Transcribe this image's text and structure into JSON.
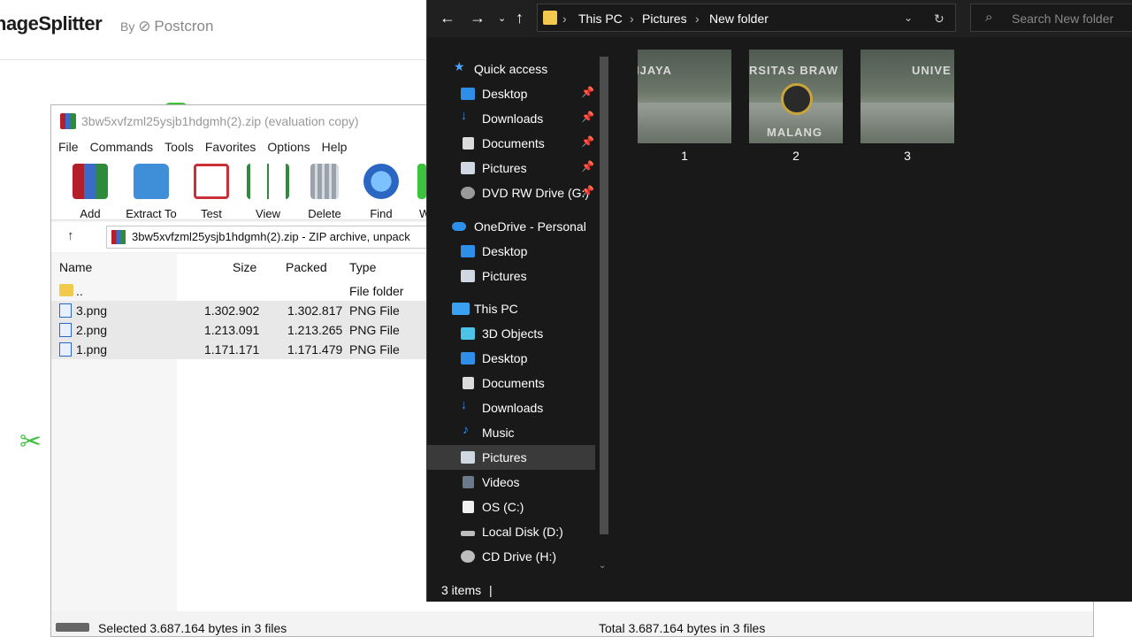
{
  "web": {
    "logo": "nageSplitter",
    "by": "By",
    "brand": "Postcron"
  },
  "rar": {
    "title": "3bw5xvfzml25ysjb1hdgmh(2).zip (evaluation copy)",
    "menu": [
      "File",
      "Commands",
      "Tools",
      "Favorites",
      "Options",
      "Help"
    ],
    "toolbar": [
      "Add",
      "Extract To",
      "Test",
      "View",
      "Delete",
      "Find",
      "W"
    ],
    "address": "3bw5xvfzml25ysjb1hdgmh(2).zip - ZIP archive, unpack",
    "columns": {
      "name": "Name",
      "size": "Size",
      "packed": "Packed",
      "type": "Type"
    },
    "rows": [
      {
        "name": "..",
        "size": "",
        "packed": "",
        "type": "File folder"
      },
      {
        "name": "3.png",
        "size": "1.302.902",
        "packed": "1.302.817",
        "type": "PNG File"
      },
      {
        "name": "2.png",
        "size": "1.213.091",
        "packed": "1.213.265",
        "type": "PNG File"
      },
      {
        "name": "1.png",
        "size": "1.171.171",
        "packed": "1.171.479",
        "type": "PNG File"
      }
    ],
    "status_left": "Selected 3.687.164 bytes in 3 files",
    "status_right": "Total 3.687.164 bytes in 3 files"
  },
  "explorer": {
    "path": [
      "This PC",
      "Pictures",
      "New folder"
    ],
    "search_placeholder": "Search New folder",
    "nav": [
      {
        "label": "Quick access",
        "icon": "star-icon",
        "pinned": false
      },
      {
        "label": "Desktop",
        "icon": "desktop-icon",
        "pinned": true
      },
      {
        "label": "Downloads",
        "icon": "download-icon",
        "pinned": true
      },
      {
        "label": "Documents",
        "icon": "document-icon",
        "pinned": true
      },
      {
        "label": "Pictures",
        "icon": "pictures-icon",
        "pinned": true
      },
      {
        "label": "DVD RW Drive (G:)",
        "icon": "dvd-icon",
        "pinned": true
      },
      {
        "label": "OneDrive - Personal",
        "icon": "cloud-icon",
        "pinned": false
      },
      {
        "label": "Desktop",
        "icon": "desktop-icon",
        "pinned": false
      },
      {
        "label": "Pictures",
        "icon": "pictures-icon",
        "pinned": false
      },
      {
        "label": "This PC",
        "icon": "pc-icon",
        "pinned": false
      },
      {
        "label": "3D Objects",
        "icon": "cube-icon",
        "pinned": false
      },
      {
        "label": "Desktop",
        "icon": "desktop-icon",
        "pinned": false
      },
      {
        "label": "Documents",
        "icon": "document-icon",
        "pinned": false
      },
      {
        "label": "Downloads",
        "icon": "download-icon",
        "pinned": false
      },
      {
        "label": "Music",
        "icon": "music-icon",
        "pinned": false
      },
      {
        "label": "Pictures",
        "icon": "pictures-icon",
        "pinned": false
      },
      {
        "label": "Videos",
        "icon": "video-icon",
        "pinned": false
      },
      {
        "label": "OS (C:)",
        "icon": "drive-icon",
        "pinned": false
      },
      {
        "label": "Local Disk (D:)",
        "icon": "drive-icon",
        "pinned": false
      },
      {
        "label": "CD Drive (H:)",
        "icon": "cd-icon",
        "pinned": false
      }
    ],
    "files": [
      {
        "label": "1",
        "thumb_text": "IJAYA"
      },
      {
        "label": "2",
        "thumb_text": "RSITAS BRAW",
        "thumb_text2": "MALANG"
      },
      {
        "label": "3",
        "thumb_text": "UNIVE"
      }
    ],
    "status": "3 items"
  }
}
